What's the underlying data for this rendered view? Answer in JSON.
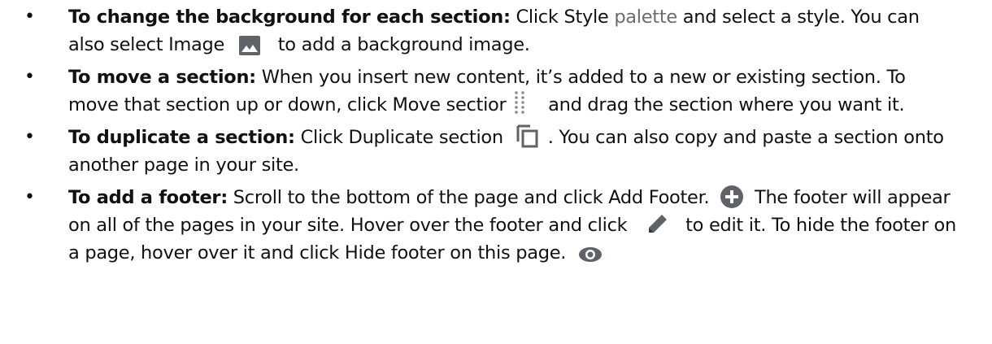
{
  "bullet_char": "•",
  "items": [
    {
      "lead": "To change the background for each section:",
      "t1": " Click Style ",
      "muted": "palette",
      "t2": " and select a style. You can also select Image ",
      "t3": " to add a background image."
    },
    {
      "lead": "To move a section:",
      "t1": " When you insert new content, it’s added to a new or existing section. To move that section up or down, click Move sectior ",
      "t2": " and drag the section where you want it."
    },
    {
      "lead": "To duplicate a section:",
      "t1": " Click Duplicate section ",
      "t2": ". You can also copy and paste a section onto another page in your site."
    },
    {
      "lead": "To add a footer:",
      "t1": " Scroll to the bottom of the page and click Add Footer. ",
      "t2": " The footer will appear on all of the pages in your site. Hover over the footer and click ",
      "t3": " to edit it. To hide the footer on a page, hover over it and click Hide footer on this page. "
    }
  ],
  "icons": {
    "image": "image-icon",
    "drag": "drag-handle-icon",
    "duplicate": "duplicate-icon",
    "add": "add-circle-icon",
    "edit": "pencil-icon",
    "visibility": "eye-icon"
  },
  "colors": {
    "text": "#111111",
    "muted": "#6b6b6b",
    "icon_gray": "#5f6368",
    "icon_dark": "#444444"
  }
}
